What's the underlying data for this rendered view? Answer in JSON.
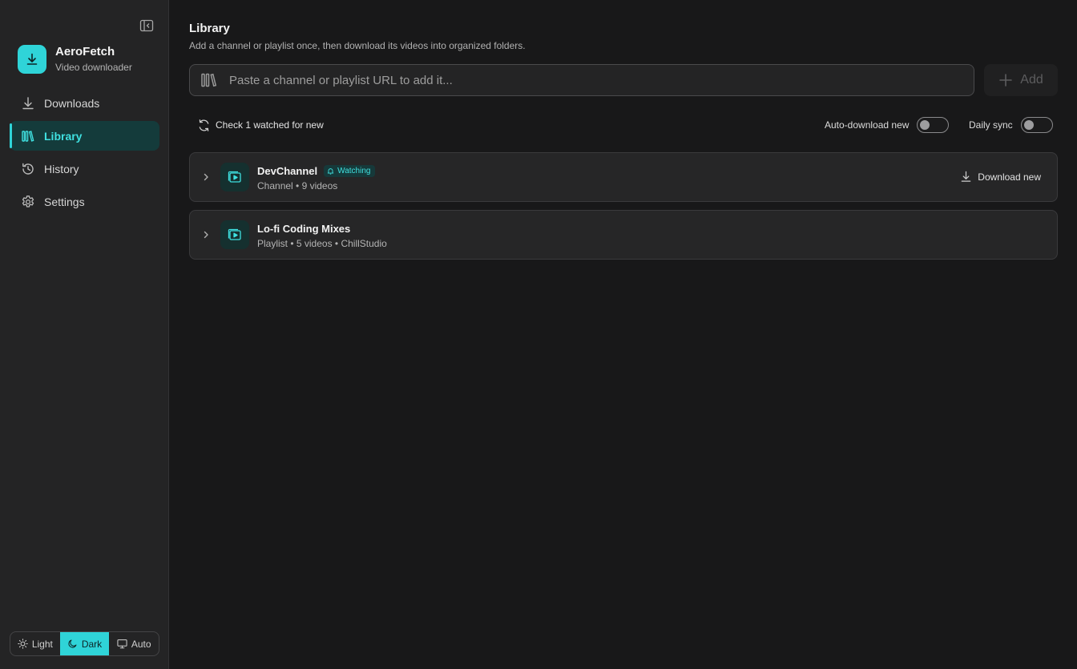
{
  "app": {
    "name": "AeroFetch",
    "subtitle": "Video downloader"
  },
  "sidebar": {
    "items": [
      {
        "label": "Downloads",
        "icon": "download-icon",
        "active": false
      },
      {
        "label": "Library",
        "icon": "library-icon",
        "active": true
      },
      {
        "label": "History",
        "icon": "history-icon",
        "active": false
      },
      {
        "label": "Settings",
        "icon": "gear-icon",
        "active": false
      }
    ],
    "theme": {
      "options": [
        {
          "label": "Light",
          "icon": "sun-icon"
        },
        {
          "label": "Dark",
          "icon": "moon-icon"
        },
        {
          "label": "Auto",
          "icon": "monitor-icon"
        }
      ],
      "selected": "Dark"
    }
  },
  "main": {
    "title": "Library",
    "subtitle": "Add a channel or playlist once, then download its videos into organized folders.",
    "url_input": {
      "placeholder": "Paste a channel or playlist URL to add it...",
      "value": ""
    },
    "add_label": "Add",
    "check_label": "Check 1 watched for new",
    "toggles": {
      "auto_download": {
        "label": "Auto-download new",
        "on": false
      },
      "daily_sync": {
        "label": "Daily sync",
        "on": false
      }
    },
    "items": [
      {
        "title": "DevChannel",
        "badge": "Watching",
        "meta": "Channel • 9 videos",
        "action": "Download new"
      },
      {
        "title": "Lo-fi Coding Mixes",
        "badge": "",
        "meta": "Playlist • 5 videos • ChillStudio",
        "action": ""
      }
    ]
  },
  "colors": {
    "accent": "#2fd4d8",
    "background": "#181819",
    "sidebar": "#242425",
    "card": "#262627"
  }
}
